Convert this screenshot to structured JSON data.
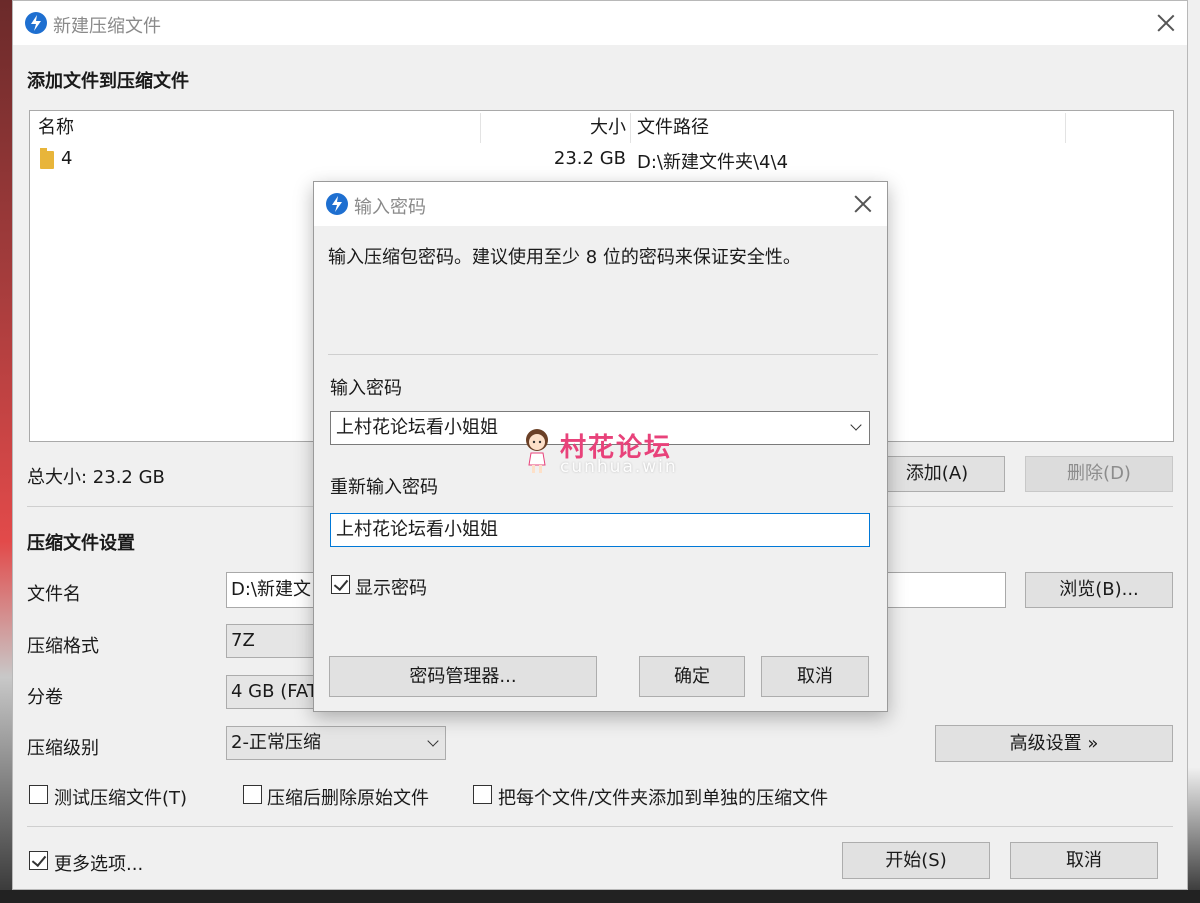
{
  "main_window": {
    "title": "新建压缩文件",
    "files_section_title": "添加文件到压缩文件",
    "columns": [
      "名称",
      "大小",
      "文件路径"
    ],
    "rows": [
      {
        "name": "4",
        "size": "23.2 GB",
        "path": "D:\\新建文件夹\\4\\4"
      }
    ],
    "total_size": "总大小: 23.2 GB",
    "add_button": "添加(A)",
    "delete_button": "删除(D)",
    "settings_section_title": "压缩文件设置",
    "filename_label": "文件名",
    "filename_value": "D:\\新建文",
    "browse_button": "浏览(B)...",
    "format_label": "压缩格式",
    "format_value": "7Z",
    "split_label": "分卷",
    "split_value": "4 GB (FAT",
    "level_label": "压缩级别",
    "level_value": "2-正常压缩",
    "advanced_button": "高级设置 »",
    "test_checkbox": "测试压缩文件(T)",
    "delete_after_checkbox": "压缩后删除原始文件",
    "separate_checkbox": "把每个文件/文件夹添加到单独的压缩文件",
    "more_options_checkbox": "更多选项...",
    "start_button": "开始(S)",
    "cancel_button": "取消",
    "more_options_checked": true,
    "test_checked": false,
    "delete_after_checked": false,
    "separate_checked": false
  },
  "password_dialog": {
    "title": "输入密码",
    "message": "输入压缩包密码。建议使用至少 8 位的密码来保证安全性。",
    "password_label": "输入密码",
    "password_value": "上村花论坛看小姐姐",
    "confirm_label": "重新输入密码",
    "confirm_value": "上村花论坛看小姐姐",
    "show_password_label": "显示密码",
    "show_password_checked": true,
    "manager_button": "密码管理器...",
    "ok_button": "确定",
    "cancel_button": "取消"
  },
  "watermark": {
    "text_cn": "村花论坛",
    "text_en": "cunhua.win"
  },
  "colors": {
    "accent": "#0078d7",
    "app_icon": "#1e6fd0",
    "watermark": "#e8427a"
  }
}
